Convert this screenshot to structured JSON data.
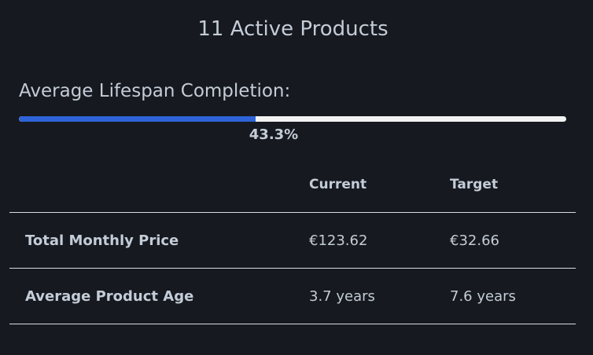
{
  "summary": {
    "title": "11 Active Products"
  },
  "lifespan": {
    "label": "Average Lifespan Completion:",
    "progress_percent": 43.3,
    "progress_text": "43.3%",
    "fill_color": "#2e64d8",
    "track_color": "#f2f2f2"
  },
  "comparison_table": {
    "columns": [
      "",
      "Current",
      "Target"
    ],
    "rows": [
      {
        "label": "Total Monthly Price",
        "current": "€123.62",
        "target": "€32.66"
      },
      {
        "label": "Average Product Age",
        "current": "3.7 years",
        "target": "7.6 years"
      }
    ]
  },
  "colors": {
    "background": "#16191f",
    "text": "#c3ccd7",
    "divider": "#d9dde2"
  }
}
